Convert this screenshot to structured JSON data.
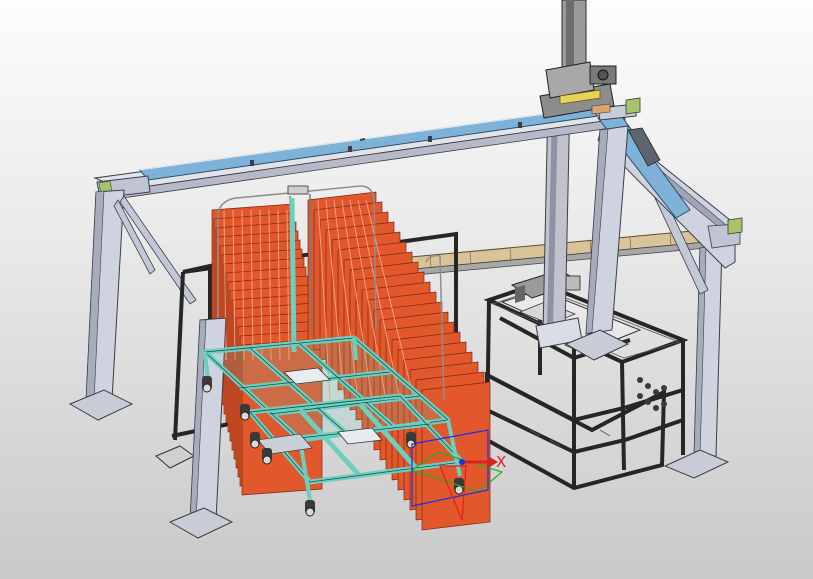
{
  "viewport": {
    "background_top": "#fdfdfd",
    "background_bottom": "#c9c9c9"
  },
  "triad": {
    "x_label": "X",
    "x_color": "#e02020",
    "y_color": "#21b021",
    "z_color": "#2030e0"
  },
  "colors": {
    "frame_fill": "#cfd3df",
    "frame_edge": "#3a3d48",
    "rail_blue": "#7fb2d8",
    "cart_teal": "#6ccfc0",
    "panel_orange": "#e2572b",
    "cell_dark": "#262626",
    "motor_gray": "#8c8c8c"
  },
  "parts": [
    "gantry-frame",
    "y-axis-rail",
    "x-axis-rail",
    "vertical-z-axis",
    "trolley-cart",
    "orange-tray-stack",
    "cart-caster",
    "black-cell-frame",
    "back-conveyor",
    "coordinate-triad"
  ]
}
